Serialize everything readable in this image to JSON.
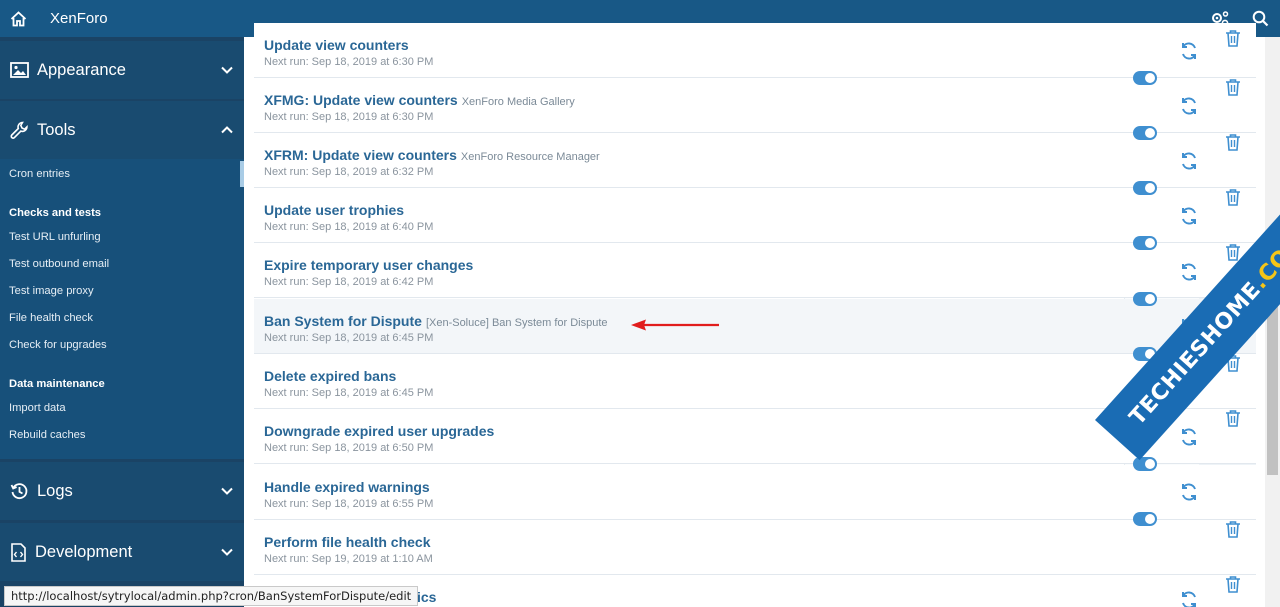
{
  "topbar": {
    "brand": "XenForo"
  },
  "sidebar": {
    "sections": [
      {
        "label": "Appearance",
        "icon": "image-icon"
      },
      {
        "label": "Tools",
        "icon": "wrench-icon"
      },
      {
        "label": "Logs",
        "icon": "history-icon"
      },
      {
        "label": "Development",
        "icon": "code-file-icon"
      }
    ],
    "tools": {
      "cron": "Cron entries",
      "checks_head": "Checks and tests",
      "checks": [
        "Test URL unfurling",
        "Test outbound email",
        "Test image proxy",
        "File health check",
        "Check for upgrades"
      ],
      "data_head": "Data maintenance",
      "data": [
        "Import data",
        "Rebuild caches"
      ]
    }
  },
  "rows": [
    {
      "title": "Update view counters",
      "addon": "",
      "next": "Next run: Sep 18, 2019 at 6:30 PM"
    },
    {
      "title": "XFMG: Update view counters",
      "addon": "XenForo Media Gallery",
      "next": "Next run: Sep 18, 2019 at 6:30 PM"
    },
    {
      "title": "XFRM: Update view counters",
      "addon": "XenForo Resource Manager",
      "next": "Next run: Sep 18, 2019 at 6:32 PM"
    },
    {
      "title": "Update user trophies",
      "addon": "",
      "next": "Next run: Sep 18, 2019 at 6:40 PM"
    },
    {
      "title": "Expire temporary user changes",
      "addon": "",
      "next": "Next run: Sep 18, 2019 at 6:42 PM"
    },
    {
      "title": "Ban System for Dispute",
      "addon": "[Xen-Soluce] Ban System for Dispute",
      "next": "Next run: Sep 18, 2019 at 6:45 PM"
    },
    {
      "title": "Delete expired bans",
      "addon": "",
      "next": "Next run: Sep 18, 2019 at 6:45 PM"
    },
    {
      "title": "Downgrade expired user upgrades",
      "addon": "",
      "next": "Next run: Sep 18, 2019 at 6:50 PM"
    },
    {
      "title": "Handle expired warnings",
      "addon": "",
      "next": "Next run: Sep 18, 2019 at 6:55 PM"
    },
    {
      "title": "Perform file health check",
      "addon": "",
      "next": "Next run: Sep 19, 2019 at 1:10 AM"
    },
    {
      "title": "tistics",
      "addon": "",
      "next": ""
    }
  ],
  "status_url": "http://localhost/sytrylocal/admin.php?cron/BanSystemForDispute/edit",
  "watermark": {
    "text": "TECHIESHOME",
    "suffix": ".COM"
  },
  "colors": {
    "topbar": "#185886",
    "sidebar": "#1a4365",
    "link": "#2a6796",
    "toggle": "#3f8fd0"
  }
}
